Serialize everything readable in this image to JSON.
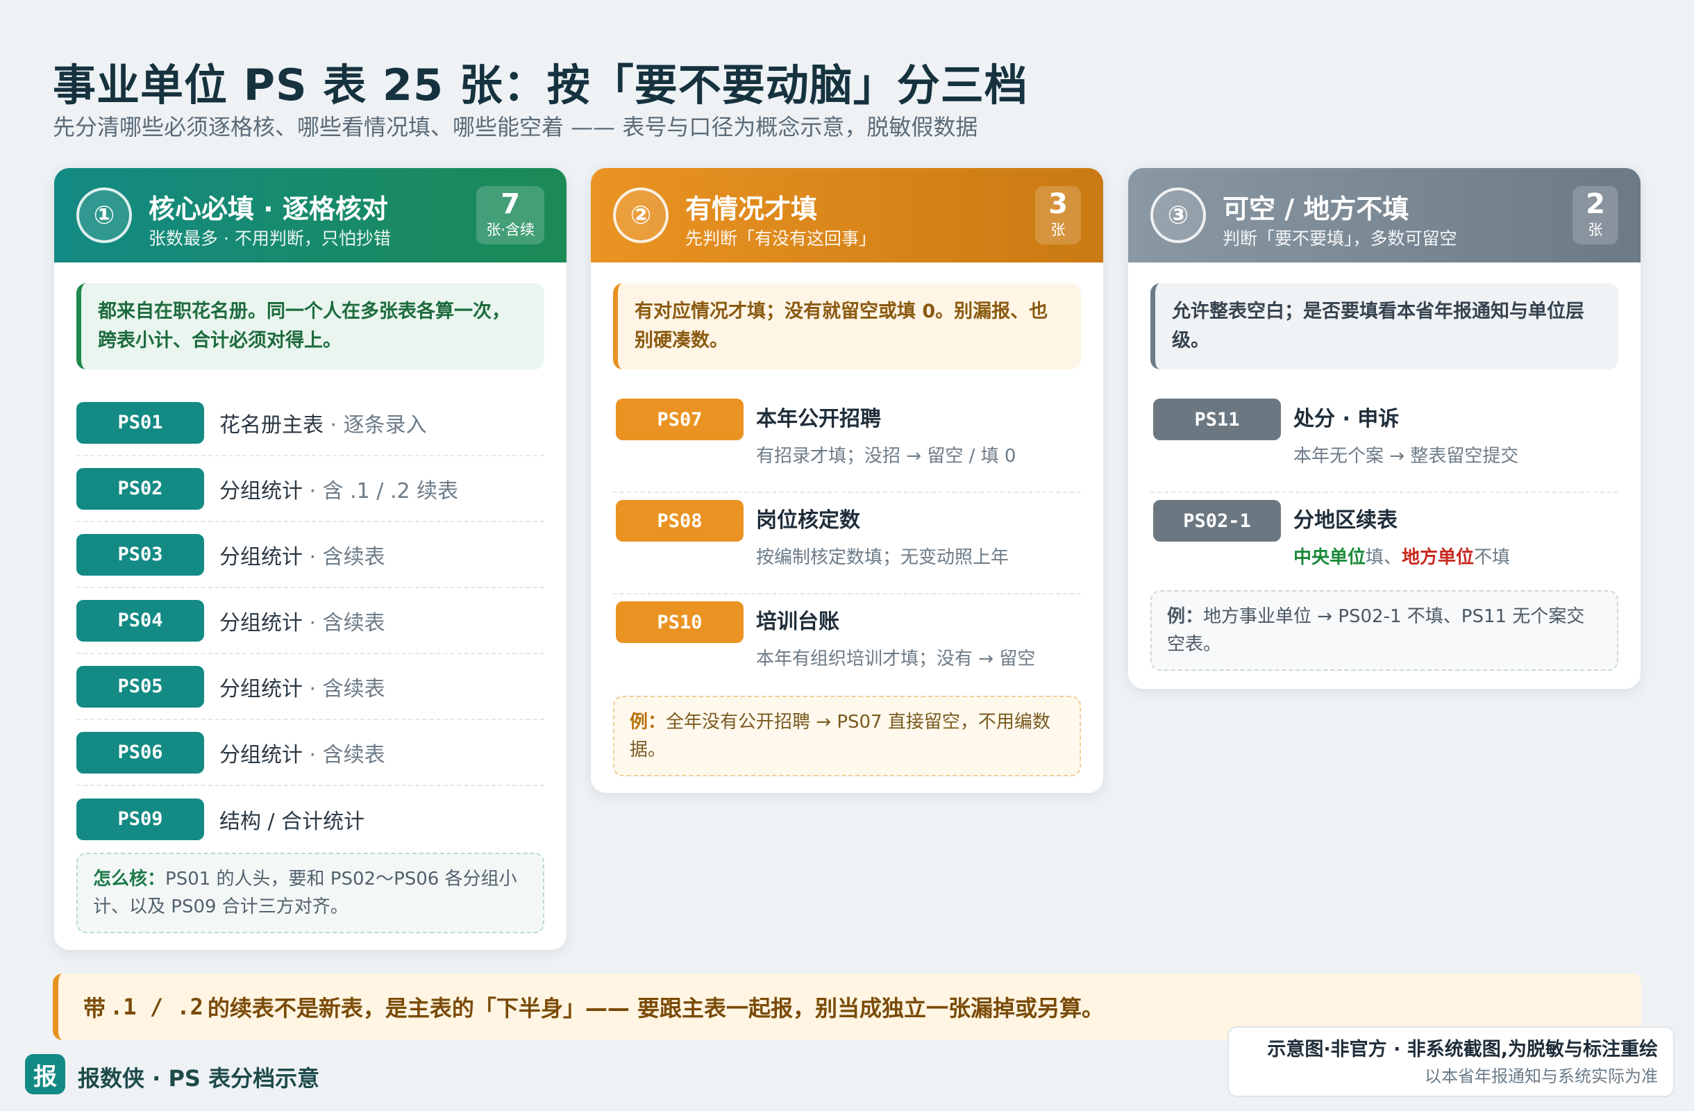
{
  "header": {
    "title": "事业单位 PS 表 25 张：按「要不要动脑」分三档",
    "subtitle": "先分清哪些必须逐格核、哪些看情况填、哪些能空着 —— 表号与口径为概念示意，脱敏假数据"
  },
  "cards": [
    {
      "num": "①",
      "title": "核心必填 · 逐格核对",
      "sub": "张数最多 · 不用判断，只怕抄错",
      "count": "7",
      "count_unit": "张·含续",
      "note": "都来自在职花名册。同一个人在多张表各算一次，跨表小计、合计必须对得上。",
      "rows": [
        {
          "code": "PS01",
          "main": "花名册主表",
          "sub": " · 逐条录入"
        },
        {
          "code": "PS02",
          "main": "分组统计",
          "sub": " · 含 .1 / .2 续表"
        },
        {
          "code": "PS03",
          "main": "分组统计",
          "sub": " · 含续表"
        },
        {
          "code": "PS04",
          "main": "分组统计",
          "sub": " · 含续表"
        },
        {
          "code": "PS05",
          "main": "分组统计",
          "sub": " · 含续表"
        },
        {
          "code": "PS06",
          "main": "分组统计",
          "sub": " · 含续表"
        },
        {
          "code": "PS09",
          "main": "结构 / 合计统计",
          "sub": ""
        }
      ],
      "example_label": "怎么核：",
      "example_text": "PS01 的人头，要和 PS02～PS06 各分组小计、以及 PS09 合计三方对齐。"
    },
    {
      "num": "②",
      "title": "有情况才填",
      "sub": "先判断「有没有这回事」",
      "count": "3",
      "count_unit": "张",
      "note": "有对应情况才填；没有就留空或填 0。别漏报、也别硬凑数。",
      "rows": [
        {
          "code": "PS07",
          "name": "本年公开招聘",
          "detail": "有招录才填；没招 → 留空 / 填 0"
        },
        {
          "code": "PS08",
          "name": "岗位核定数",
          "detail": "按编制核定数填；无变动照上年"
        },
        {
          "code": "PS10",
          "name": "培训台账",
          "detail": "本年有组织培训才填；没有 → 留空"
        }
      ],
      "example_label": "例：",
      "example_text": "全年没有公开招聘 → PS07 直接留空，不用编数据。"
    },
    {
      "num": "③",
      "title": "可空 / 地方不填",
      "sub": "判断「要不要填」，多数可留空",
      "count": "2",
      "count_unit": "张",
      "note": "允许整表空白；是否要填看本省年报通知与单位层级。",
      "rows": [
        {
          "code": "PS11",
          "name": "处分 · 申诉",
          "detail": "本年无个案 → 整表留空提交"
        },
        {
          "code": "PS02-1",
          "name": "分地区续表",
          "detail_parts": {
            "green": "中央单位",
            "t1": "填、",
            "red": "地方单位",
            "t2": "不填"
          }
        }
      ],
      "example_label": "例：",
      "example_text": "地方事业单位 → PS02-1 不填、PS11 无个案交空表。"
    }
  ],
  "banner": {
    "prefix": "带",
    "code": ".1 / .2",
    "text": "的续表不是新表，是主表的「下半身」—— 要跟主表一起报，别当成独立一张漏掉或另算。"
  },
  "footer": {
    "logo_char": "报",
    "brand": "报数侠 · PS 表分档示意",
    "disclaimer_line1": "示意图·非官方 · 非系统截图,为脱敏与标注重绘",
    "disclaimer_line2": "以本省年报通知与系统实际为准"
  },
  "colors": {
    "teal": "#138a84",
    "orange": "#ea9323",
    "gray": "#6b7882",
    "green_highlight": "#1a8a3a",
    "red_highlight": "#c8281e"
  }
}
